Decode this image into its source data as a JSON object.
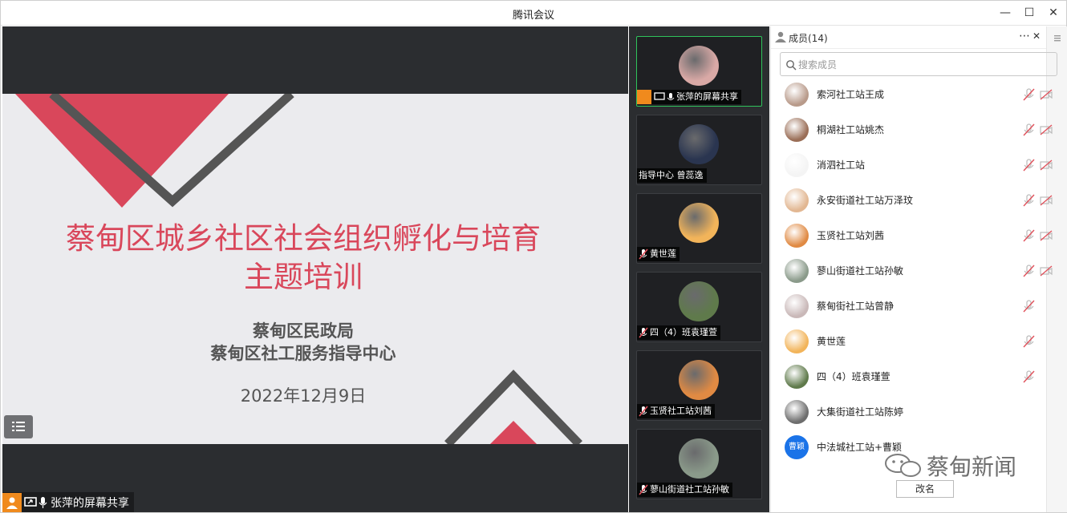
{
  "window": {
    "title": "腾讯会议",
    "controls": [
      "—",
      "☐",
      "✕"
    ]
  },
  "slide": {
    "title_line1": "蔡甸区城乡社区社会组织孵化与培育",
    "title_line2": "主题培训",
    "org_line1": "蔡甸区民政局",
    "org_line2": "蔡甸区社工服务指导中心",
    "date": "2022年12月9日"
  },
  "share_bar": {
    "label": "张萍的屏幕共享"
  },
  "gallery": {
    "tiles": [
      {
        "label": "张萍的屏幕共享",
        "muted": false,
        "active": true,
        "avatar_color": "#d9a9a6"
      },
      {
        "label": "指导中心 曾蕊逸",
        "muted": false,
        "active": false,
        "avatar_color": "#2a3550"
      },
      {
        "label": "黄世莲",
        "muted": true,
        "active": false,
        "avatar_color": "#f2b45a"
      },
      {
        "label": "四（4）班袁瑾萱",
        "muted": true,
        "active": false,
        "avatar_color": "#5f7a4b"
      },
      {
        "label": "玉贤社工站刘茜",
        "muted": true,
        "active": false,
        "avatar_color": "#e08a43"
      },
      {
        "label": "蓼山街道社工站孙敏",
        "muted": true,
        "active": false,
        "avatar_color": "#8a9a8a"
      }
    ]
  },
  "panel": {
    "title": "成员(14)",
    "more": "⋯",
    "close": "✕",
    "search_placeholder": "搜索成员",
    "members": [
      {
        "name": "索河社工站王成",
        "avatar_color": "#b89a8a",
        "mic_off": true,
        "cam_off": true
      },
      {
        "name": "桐湖社工站姚杰",
        "avatar_color": "#9a6e57",
        "mic_off": true,
        "cam_off": true
      },
      {
        "name": "消泗社工站",
        "avatar_color": "#f4f4f4",
        "mic_off": true,
        "cam_off": true
      },
      {
        "name": "永安街道社工站万泽玟",
        "avatar_color": "#e2b792",
        "mic_off": true,
        "cam_off": true
      },
      {
        "name": "玉贤社工站刘茜",
        "avatar_color": "#e08a43",
        "mic_off": true,
        "cam_off": true
      },
      {
        "name": "蓼山街道社工站孙敏",
        "avatar_color": "#8a9a8a",
        "mic_off": true,
        "cam_off": true
      },
      {
        "name": "蔡甸街社工站曾静",
        "avatar_color": "#c9b8b8",
        "mic_off": true,
        "cam_off": false
      },
      {
        "name": "黄世莲",
        "avatar_color": "#f2b45a",
        "mic_off": true,
        "cam_off": false
      },
      {
        "name": "四（4）班袁瑾萱",
        "avatar_color": "#5f7a4b",
        "mic_off": true,
        "cam_off": false
      },
      {
        "name": "大集街道社工站陈婷",
        "avatar_color": "#6d6d6d",
        "mic_off": false,
        "cam_off": false
      },
      {
        "name": "中法城社工站+曹颖",
        "avatar_color": "#1a73e8",
        "avatar_text": "曹颖",
        "mic_off": false,
        "cam_off": false
      }
    ],
    "rename_label": "改名"
  },
  "watermark": {
    "text": "蔡甸新闻"
  },
  "colors": {
    "accent_red": "#d9475b",
    "active_green": "#2fc35b",
    "share_orange": "#f08a1d",
    "muted_red": "#e0505a"
  }
}
